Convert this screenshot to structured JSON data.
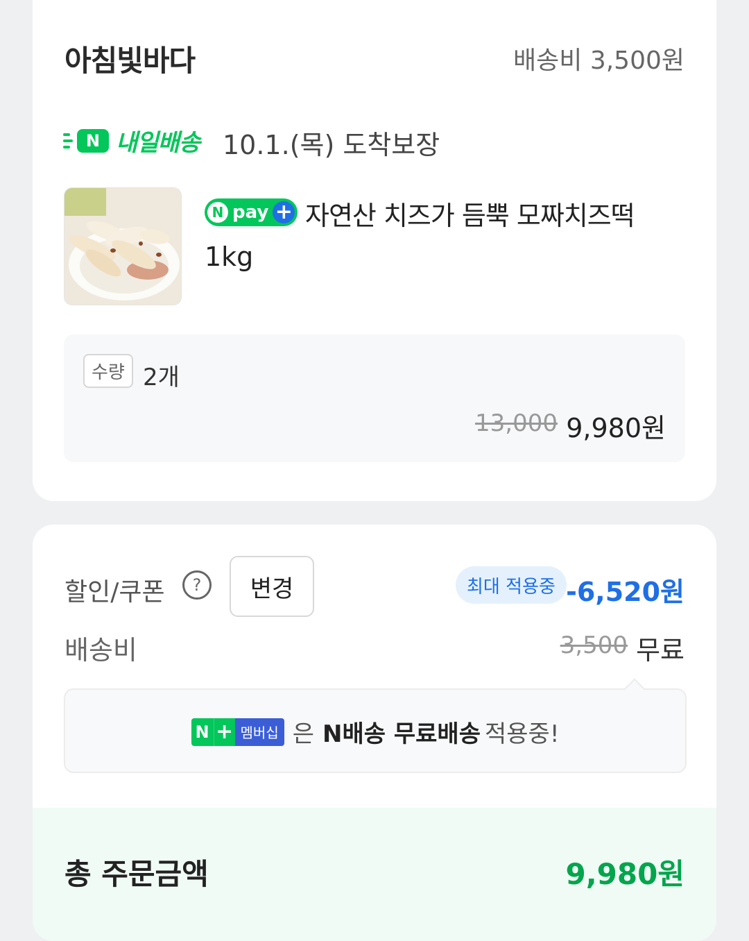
{
  "seller": {
    "name": "아침빛바다",
    "shipping_fee_label": "배송비 3,500원"
  },
  "delivery": {
    "badge_letter": "N",
    "badge_label": "내일배송",
    "arrival": "10.1.(목) 도착보장"
  },
  "product": {
    "npay_n": "N",
    "npay_text": "pay",
    "npay_plus": "+",
    "name_line1": "자연산 치즈가 듬뿍 모짜치즈떡",
    "name_line2": "1kg",
    "quantity_label": "수량",
    "quantity_value": "2개",
    "original_price": "13,000",
    "sale_price": "9,980원"
  },
  "discount": {
    "label": "할인/쿠폰",
    "help_icon": "?",
    "change_button": "변경",
    "max_applied": "최대 적용중",
    "amount": "-6,520원"
  },
  "shipping": {
    "label": "배송비",
    "original": "3,500",
    "final": "무료"
  },
  "membership": {
    "tag_n": "N",
    "tag_plus": "+",
    "tag_text": "멤버십",
    "text_particle": "은",
    "text_strong": "N배송 무료배송",
    "text_end": "적용중!"
  },
  "total": {
    "label": "총 주문금액",
    "amount": "9,980원"
  },
  "colors": {
    "naver_green": "#03c75a",
    "discount_blue": "#1f6fe5",
    "total_green": "#03a54d"
  }
}
